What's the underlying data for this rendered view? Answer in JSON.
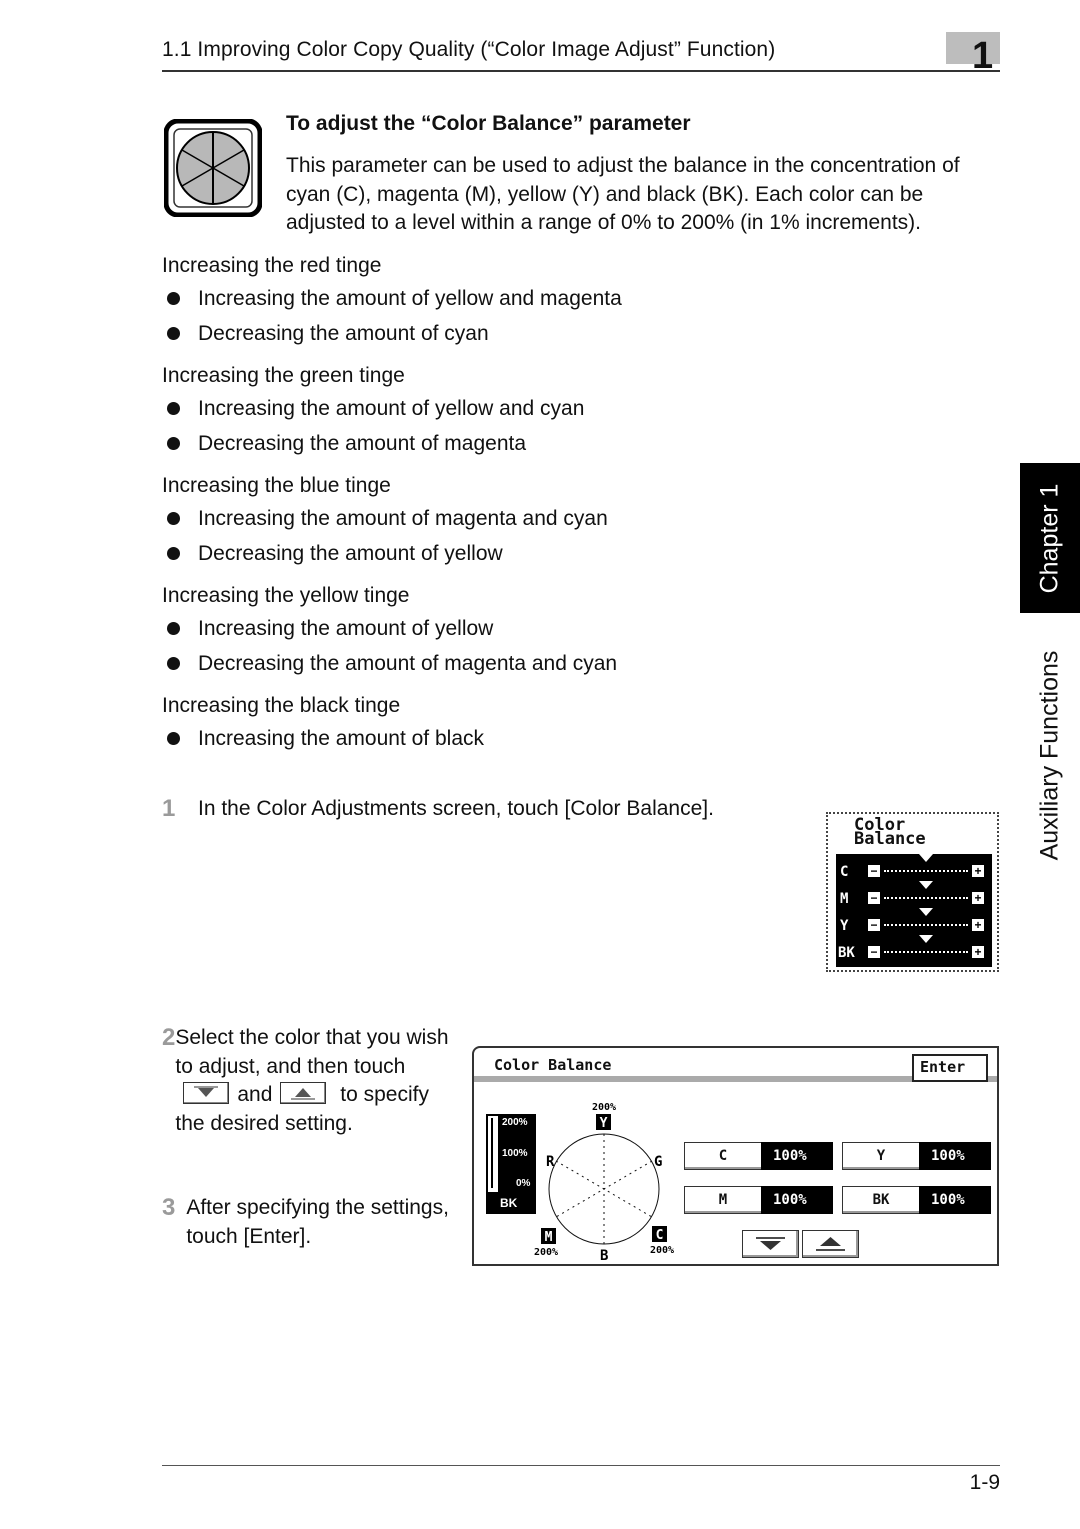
{
  "header": {
    "title": "1.1 Improving Color Copy Quality (“Color Image Adjust” Function)",
    "chapter_number": "1"
  },
  "param_icon": "color-balance-wheel-icon",
  "section": {
    "heading": "To adjust the “Color Balance” parameter",
    "description": "This parameter can be used to adjust the balance in the concentration of cyan (C), magenta (M), yellow (Y) and black (BK). Each color can be adjusted to a level within a range of 0% to 200% (in 1% increments)."
  },
  "tinges": [
    {
      "title": "Increasing the red tinge",
      "items": [
        "Increasing the amount of yellow and magenta",
        "Decreasing the amount of cyan"
      ]
    },
    {
      "title": "Increasing the green tinge",
      "items": [
        "Increasing the amount of yellow and cyan",
        "Decreasing the amount of magenta"
      ]
    },
    {
      "title": "Increasing the blue tinge",
      "items": [
        "Increasing the amount of magenta and cyan",
        "Decreasing the amount of yellow"
      ]
    },
    {
      "title": "Increasing the yellow tinge",
      "items": [
        "Increasing the amount of yellow",
        "Decreasing the amount of magenta and cyan"
      ]
    },
    {
      "title": "Increasing the black tinge",
      "items": [
        "Increasing the amount of black"
      ]
    }
  ],
  "side_tab": {
    "chapter": "Chapter 1",
    "section": "Auxiliary Functions"
  },
  "steps": [
    {
      "num": "1",
      "text": "In the Color Adjustments screen, touch [Color Balance]."
    },
    {
      "num": "2",
      "text_a": "Select the color that you wish to adjust, and then touch",
      "text_b": "and",
      "text_c": "to specify the desired setting."
    },
    {
      "num": "3",
      "text": "After specifying the settings, touch [Enter]."
    }
  ],
  "small_screen": {
    "title_line1": "Color",
    "title_line2": "Balance",
    "rows": [
      {
        "label": "C",
        "level_percent": 100
      },
      {
        "label": "M",
        "level_percent": 100
      },
      {
        "label": "Y",
        "level_percent": 100
      },
      {
        "label": "BK",
        "level_percent": 100
      }
    ],
    "minus": "−",
    "plus": "+"
  },
  "large_screen": {
    "title": "Color Balance",
    "enter": "Enter",
    "bk_scale": {
      "top": "200%",
      "mid": "100%",
      "bottom": "0%",
      "label": "BK"
    },
    "wheel": {
      "Y": "Y",
      "M": "M",
      "C": "C",
      "R": "R",
      "G": "G",
      "B": "B",
      "y_pct": "200%",
      "m_pct": "200%",
      "c_pct": "200%"
    },
    "buttons": [
      {
        "name": "C",
        "value": "100%"
      },
      {
        "name": "Y",
        "value": "100%"
      },
      {
        "name": "M",
        "value": "100%"
      },
      {
        "name": "BK",
        "value": "100%"
      }
    ]
  },
  "footer": {
    "page": "1-9"
  }
}
